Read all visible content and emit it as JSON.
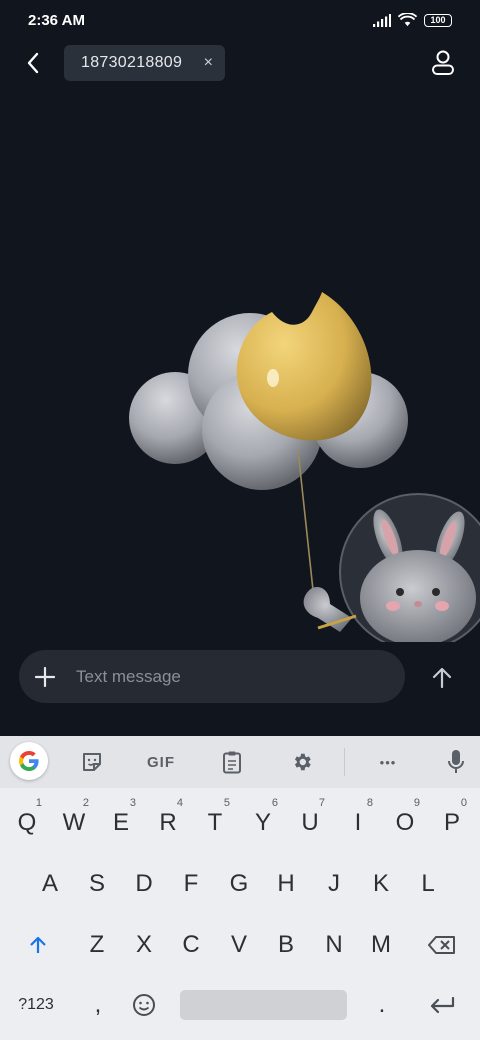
{
  "status_bar": {
    "time": "2:36 AM",
    "battery": "100"
  },
  "header": {
    "recipient": "18730218809",
    "remove_glyph": "×"
  },
  "compose": {
    "placeholder": "Text message"
  },
  "keyboard": {
    "toolbar": {
      "gif_label": "GIF",
      "more_glyph": "•••"
    },
    "row1": [
      {
        "k": "Q",
        "h": "1"
      },
      {
        "k": "W",
        "h": "2"
      },
      {
        "k": "E",
        "h": "3"
      },
      {
        "k": "R",
        "h": "4"
      },
      {
        "k": "T",
        "h": "5"
      },
      {
        "k": "Y",
        "h": "6"
      },
      {
        "k": "U",
        "h": "7"
      },
      {
        "k": "I",
        "h": "8"
      },
      {
        "k": "O",
        "h": "9"
      },
      {
        "k": "P",
        "h": "0"
      }
    ],
    "row2": [
      "A",
      "S",
      "D",
      "F",
      "G",
      "H",
      "J",
      "K",
      "L"
    ],
    "row3": [
      "Z",
      "X",
      "C",
      "V",
      "B",
      "N",
      "M"
    ],
    "bottom": {
      "symbols": "?123",
      "comma": ",",
      "period": "."
    }
  },
  "colors": {
    "background": "#11151d",
    "chip": "#2b313b",
    "compose": "#252a33",
    "keyboard": "#eceef1",
    "shift_accent": "#1a73e8",
    "moon": "#e6be57"
  },
  "icons": {
    "back": "back-arrow-icon",
    "contact": "person-icon",
    "plus": "plus-icon",
    "send": "send-arrow-icon",
    "google": "google-g-icon",
    "sticker": "sticker-icon",
    "clipboard": "clipboard-icon",
    "settings": "gear-icon",
    "mic": "microphone-icon",
    "shift": "shift-arrow-icon",
    "backspace": "backspace-icon",
    "emoji": "emoji-icon",
    "enter": "enter-icon"
  }
}
